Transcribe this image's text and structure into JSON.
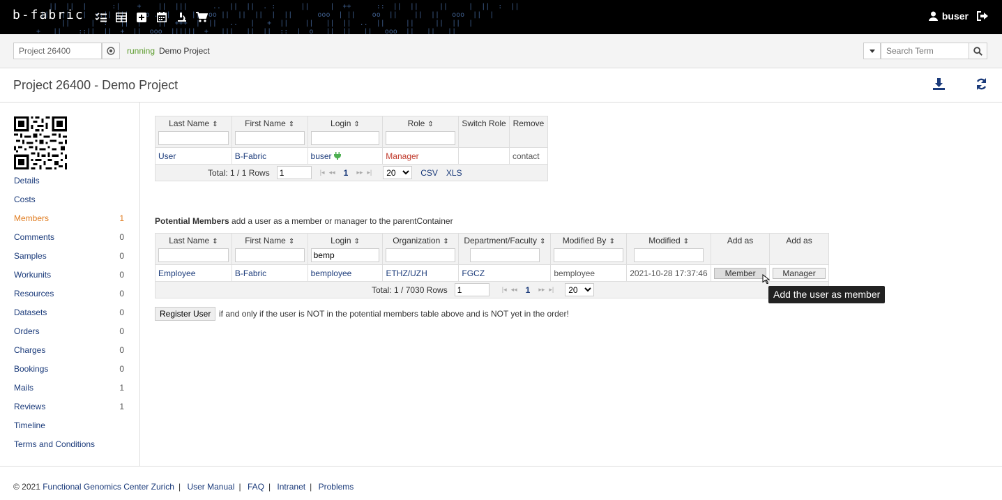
{
  "topbar": {
    "logo": "b-fabric",
    "user": "buser"
  },
  "subbar": {
    "project_value": "Project 26400",
    "status": "running",
    "project_name": "Demo Project",
    "search_placeholder": "Search Term"
  },
  "page": {
    "title": "Project 26400 - Demo Project"
  },
  "sidebar": {
    "items": [
      {
        "label": "Details",
        "count": ""
      },
      {
        "label": "Costs",
        "count": ""
      },
      {
        "label": "Members",
        "count": "1"
      },
      {
        "label": "Comments",
        "count": "0"
      },
      {
        "label": "Samples",
        "count": "0"
      },
      {
        "label": "Workunits",
        "count": "0"
      },
      {
        "label": "Resources",
        "count": "0"
      },
      {
        "label": "Datasets",
        "count": "0"
      },
      {
        "label": "Orders",
        "count": "0"
      },
      {
        "label": "Charges",
        "count": "0"
      },
      {
        "label": "Bookings",
        "count": "0"
      },
      {
        "label": "Mails",
        "count": "1"
      },
      {
        "label": "Reviews",
        "count": "1"
      },
      {
        "label": "Timeline",
        "count": ""
      },
      {
        "label": "Terms and Conditions",
        "count": ""
      }
    ]
  },
  "members_table": {
    "headers": [
      "Last Name",
      "First Name",
      "Login",
      "Role",
      "Switch Role",
      "Remove"
    ],
    "row": {
      "last": "User",
      "first": "B-Fabric",
      "login": "buser",
      "role": "Manager",
      "switch": "",
      "remove": "contact"
    },
    "total": "Total: 1 / 1 Rows",
    "page_input": "1",
    "current_page": "1",
    "page_size": "20",
    "csv": "CSV",
    "xls": "XLS"
  },
  "potential": {
    "title": "Potential Members",
    "description": "add a user as a member or manager to the parentContainer",
    "headers": [
      "Last Name",
      "First Name",
      "Login",
      "Organization",
      "Department/Faculty",
      "Modified By",
      "Modified",
      "Add as",
      "Add as"
    ],
    "login_filter": "bemp",
    "row": {
      "last": "Employee",
      "first": "B-Fabric",
      "login": "bemployee",
      "org": "ETHZ/UZH",
      "dept": "FGCZ",
      "modified_by": "bemployee",
      "modified": "2021-10-28 17:37:46",
      "member_btn": "Member",
      "manager_btn": "Manager"
    },
    "total": "Total: 1 / 7030 Rows",
    "page_input": "1",
    "current_page": "1",
    "page_size": "20"
  },
  "register": {
    "button": "Register User",
    "note": "if and only if the user is NOT in the potential members table above and is NOT yet in the order!"
  },
  "tooltip": "Add the user as member",
  "footer": {
    "copyright": "© 2021",
    "links": [
      "Functional Genomics Center Zurich",
      "User Manual",
      "FAQ",
      "Intranet",
      "Problems"
    ]
  }
}
